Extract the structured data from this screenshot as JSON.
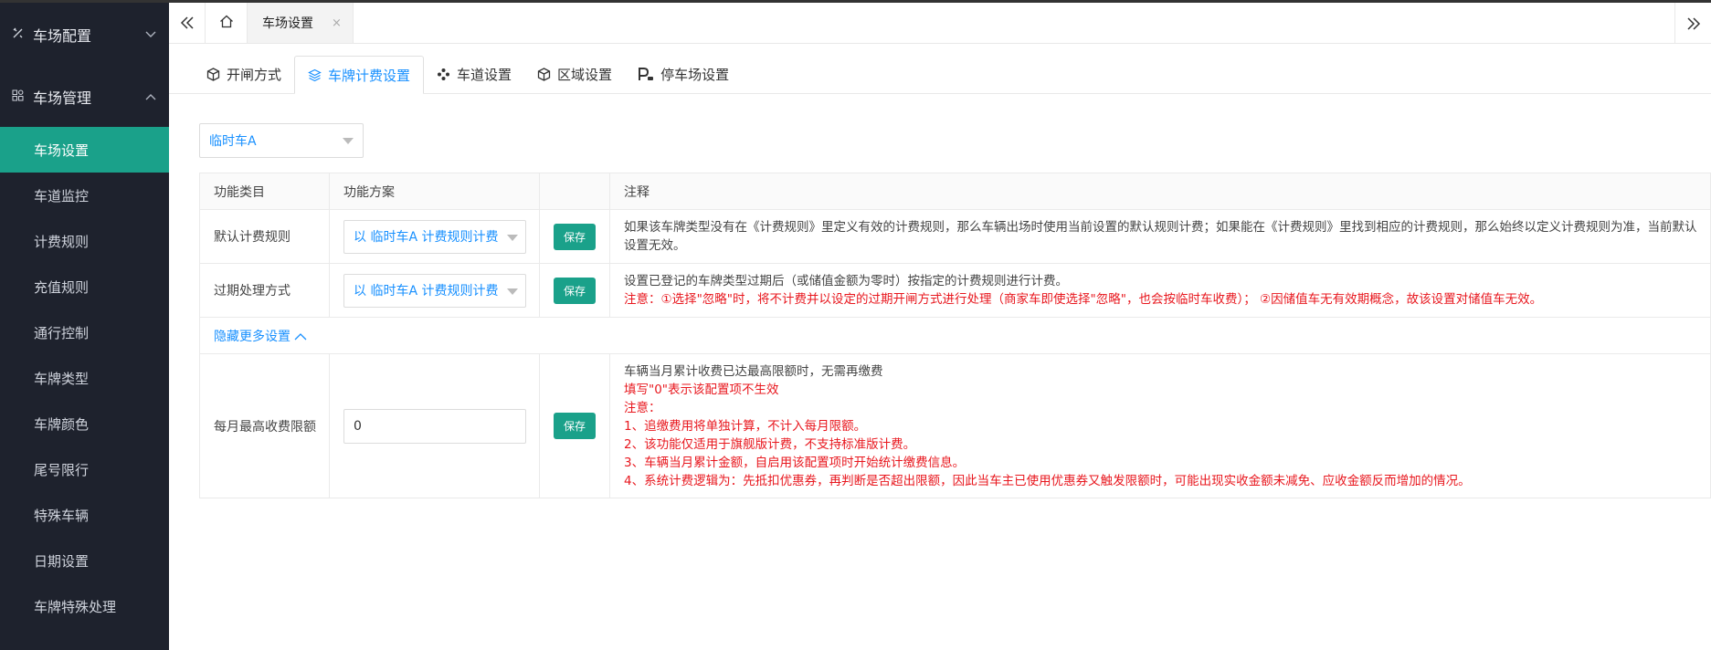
{
  "sidebar": {
    "group1": {
      "label": "车场配置",
      "icon": "tools-icon"
    },
    "group2": {
      "label": "车场管理",
      "icon": "apps-icon"
    },
    "items": [
      {
        "label": "车场设置",
        "active": true
      },
      {
        "label": "车道监控"
      },
      {
        "label": "计费规则"
      },
      {
        "label": "充值规则"
      },
      {
        "label": "通行控制"
      },
      {
        "label": "车牌类型"
      },
      {
        "label": "车牌颜色"
      },
      {
        "label": "尾号限行"
      },
      {
        "label": "特殊车辆"
      },
      {
        "label": "日期设置"
      },
      {
        "label": "车牌特殊处理"
      }
    ]
  },
  "tabbar": {
    "page_tab": "车场设置",
    "close": "×"
  },
  "subtabs": [
    {
      "label": "开闸方式",
      "icon": "cube-icon"
    },
    {
      "label": "车牌计费设置",
      "icon": "layers-icon",
      "active": true
    },
    {
      "label": "车道设置",
      "icon": "nodes-icon"
    },
    {
      "label": "区域设置",
      "icon": "box-icon"
    },
    {
      "label": "停车场设置",
      "icon": "parking-icon"
    }
  ],
  "plate_select": {
    "value": "临时车A"
  },
  "table": {
    "headers": [
      "功能类目",
      "功能方案",
      "",
      "注释"
    ],
    "save_label": "保存",
    "rows": {
      "default_rule": {
        "name": "默认计费规则",
        "value": "以 临时车A 计费规则计费",
        "note": "如果该车牌类型没有在《计费规则》里定义有效的计费规则，那么车辆出场时使用当前设置的默认规则计费；如果能在《计费规则》里找到相应的计费规则，那么始终以定义计费规则为准，当前默认设置无效。"
      },
      "expired": {
        "name": "过期处理方式",
        "value": "以 临时车A 计费规则计费",
        "note": "设置已登记的车牌类型过期后（或储值金额为零时）按指定的计费规则进行计费。",
        "note_red": "注意：①选择\"忽略\"时，将不计费并以设定的过期开闸方式进行处理（商家车即使选择\"忽略\"，也会按临时车收费）； ②因储值车无有效期概念，故该设置对储值车无效。"
      },
      "toggle": {
        "label": "隐藏更多设置",
        "icon": "chevron-up-icon"
      },
      "monthly_cap": {
        "name": "每月最高收费限额",
        "value": "0",
        "note": "车辆当月累计收费已达最高限额时，无需再缴费",
        "red_lines": [
          "填写\"0\"表示该配置项不生效",
          "注意：",
          "1、追缴费用将单独计算，不计入每月限额。",
          "2、该功能仅适用于旗舰版计费，不支持标准版计费。",
          "3、车辆当月累计金额，自启用该配置项时开始统计缴费信息。",
          "4、系统计费逻辑为：先抵扣优惠券，再判断是否超出限额，因此当车主已使用优惠券又触发限额时，可能出现实收金额未减免、应收金额反而增加的情况。"
        ]
      }
    }
  }
}
